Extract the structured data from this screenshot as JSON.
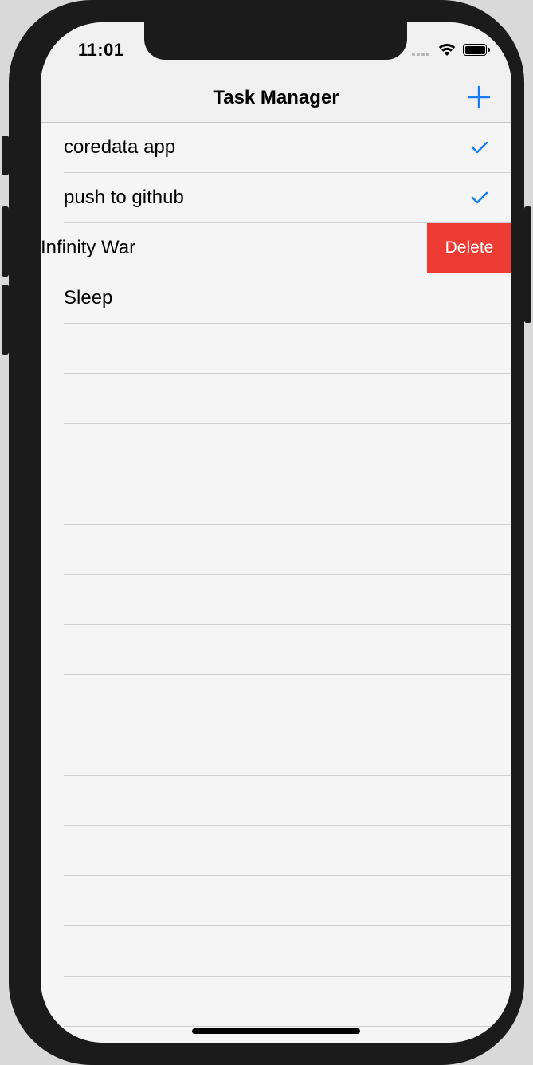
{
  "status_bar": {
    "time": "11:01"
  },
  "nav": {
    "title": "Task Manager",
    "add_icon": "plus-icon"
  },
  "tasks": [
    {
      "label": "coredata app",
      "done": true
    },
    {
      "label": "push to github",
      "done": true
    },
    {
      "label": "Infinity War",
      "done": false,
      "swiped": true,
      "action_label": "Delete"
    },
    {
      "label": "Sleep",
      "done": false
    }
  ],
  "colors": {
    "accent": "#1a7cf5",
    "delete": "#ee3b33",
    "background": "#f4f5f4"
  },
  "icons": {
    "check": "checkmark-icon",
    "wifi": "wifi-icon",
    "battery": "battery-icon",
    "signal": "signal-icon"
  }
}
